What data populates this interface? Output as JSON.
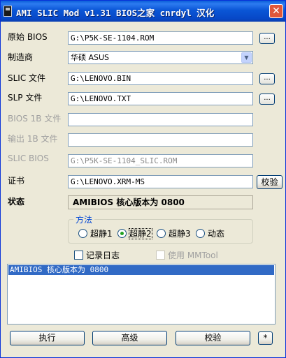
{
  "window": {
    "title": "AMI SLIC Mod v1.31  BIOS之家 cnrdyl 汉化",
    "close_label": "✕"
  },
  "fields": {
    "original_bios": {
      "label": "原始 BIOS",
      "value": "G:\\P5K-SE-1104.ROM"
    },
    "manufacturer": {
      "label": "制造商",
      "value": "华硕 ASUS"
    },
    "slic_file": {
      "label": "SLIC 文件",
      "value": "G:\\LENOVO.BIN"
    },
    "slp_file": {
      "label": "SLP 文件",
      "value": "G:\\LENOVO.TXT"
    },
    "bios_1b_file": {
      "label": "BIOS 1B 文件",
      "value": ""
    },
    "output_1b_file": {
      "label": "输出 1B 文件",
      "value": ""
    },
    "slic_bios": {
      "label": "SLIC BIOS",
      "value": "G:\\P5K-SE-1104_SLIC.ROM"
    },
    "certificate": {
      "label": "证书",
      "value": "G:\\LENOVO.XRM-MS"
    }
  },
  "browse_label": "...",
  "verify_cert_label": "校验",
  "status": {
    "label": "状态",
    "value": "AMIBIOS 核心版本为 0800"
  },
  "method": {
    "title": "方法",
    "options": [
      "超静1",
      "超静2",
      "超静3",
      "动态"
    ],
    "selected": "超静2"
  },
  "log_checkbox": {
    "label": "记录日志",
    "checked": false
  },
  "mmtool_checkbox": {
    "label": "使用 MMTool",
    "checked": false
  },
  "log_list": [
    "AMIBIOS 核心版本为 0800"
  ],
  "actions": {
    "execute": "执行",
    "advanced": "高级",
    "verify": "校验",
    "extra": "*"
  }
}
